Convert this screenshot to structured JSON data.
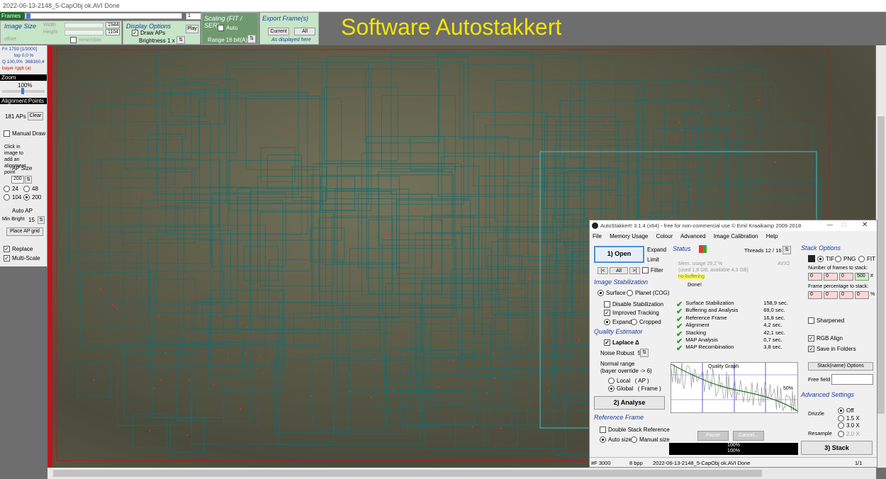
{
  "titlebar": {
    "text": "2022-06-13-2148_5-CapObj ok.AVI  Done"
  },
  "frames": {
    "label": "Frames",
    "current": "1"
  },
  "image_size": {
    "title": "Image Size",
    "width_label": "Width",
    "width_value": "1944",
    "height_label": "Height",
    "height_value": "1104",
    "remember": "remember",
    "offset": "offset"
  },
  "display_options": {
    "title": "Display Options",
    "draw_aps": "Draw APs",
    "brightness": "Brightness",
    "brightness_value": "1 x",
    "play": "Play"
  },
  "scaling": {
    "title": "Scaling (FIT / SER)",
    "auto": "Auto",
    "range": "Range 16 bit(A)"
  },
  "export": {
    "title": "Export Frame(s)",
    "current": "Current",
    "all": "All",
    "note": "As displayed here"
  },
  "heading": "Software Autostakkert",
  "left": {
    "frame_info": "F# 1759 [1/3000]",
    "top": "top 0,0 %",
    "q": "Q 100,0%",
    "q2": "368160,4",
    "bayer": "bayer rggb (a)",
    "zoom_title": "Zoom",
    "zoom_value": "100%",
    "ap_title": "Alignment Points",
    "ap_count": "181 APs",
    "clear": "Clear",
    "manual_draw": "Manual Draw",
    "click_hint": "Click in image to add an alignment point",
    "ap_size": "AP Size",
    "ap_size_value": "200",
    "sizes": [
      "24",
      "48",
      "104",
      "200"
    ],
    "auto_ap": "Auto AP",
    "min_bright": "Min Bright",
    "min_bright_value": "15",
    "place_grid": "Place AP grid",
    "replace": "Replace",
    "multiscale": "Multi-Scale"
  },
  "as": {
    "title": "AutoStakkert! 3.1.4 (x64) - free for non-commercial use © Emil Kraaikamp 2009-2018",
    "menu": [
      "File",
      "Memory Usage",
      "Colour",
      "Advanced",
      "Image Calibration",
      "Help"
    ],
    "open": "1) Open",
    "expand": "Expand",
    "limit": "Limit",
    "nav": [
      "|<",
      "All",
      ">|"
    ],
    "filter": "Filter",
    "stab_title": "Image Stabilization",
    "surface": "Surface",
    "planet": "Planet (COG)",
    "disable_stab": "Disable Stabilization",
    "improved_tracking": "Improved Tracking",
    "expand_opt": "Expand",
    "cropped": "Cropped",
    "qe_title": "Quality Estimator",
    "laplace": "Laplace Δ",
    "noise_robust": "Noise Robust",
    "noise_value": "5",
    "normal_range": "Normal range",
    "bayer_override": "(bayer override -> 6)",
    "local": "Local",
    "local_ap": "( AP )",
    "global": "Global",
    "global_frame": "( Frame )",
    "analyse": "2) Analyse",
    "ref_title": "Reference Frame",
    "double_stack": "Double Stack Reference",
    "auto_size": "Auto size",
    "manual_size": "Manual size",
    "status_title": "Status",
    "threads": "Threads 12 / 16",
    "mem": "Mem. usage 29,2 %",
    "mem_detail": "(used 1,8 GB, available 4,3 GB)",
    "avx": "AVX2",
    "buffering": "no buffering",
    "done": "Done!",
    "times": [
      {
        "label": "Surface Stabilization",
        "value": "158,9 sec."
      },
      {
        "label": "Buffering and Analysis",
        "value": "69,0 sec."
      },
      {
        "label": "Reference Frame",
        "value": "16,8 sec."
      },
      {
        "label": "Alignment",
        "value": "4,2 sec."
      },
      {
        "label": "Stacking",
        "value": "42,1 sec."
      },
      {
        "label": "MAP Analysis",
        "value": "0,7 sec."
      },
      {
        "label": "MAP Recombination",
        "value": "3,8 sec."
      }
    ],
    "quality_graph": "Quality Graph",
    "pct50": "50%",
    "pause": "Pause",
    "cancel": "Cancel...",
    "progress1": "100%",
    "progress2": "100%",
    "stack_title": "Stack Options",
    "formats": [
      "TIF",
      "PNG",
      "FIT"
    ],
    "frames_to_stack": "Number of frames to stack:",
    "frame_fields": [
      "0",
      "0",
      "0",
      "500"
    ],
    "frame_pct": "Frame percentage to stack:",
    "pct_fields": [
      "0",
      "0",
      "0",
      "0"
    ],
    "hash": "#",
    "pct_sym": "%",
    "sharpened": "Sharpened",
    "rgb_align": "RGB Align",
    "save_folders": "Save in Folders",
    "stackname": "Stack(name) Options",
    "free_field": "Free field",
    "adv_title": "Advanced Settings",
    "drizzle": "Drizzle",
    "drizzle_opts": [
      "Off",
      "1.5 X",
      "3.0 X"
    ],
    "resample": "Resample",
    "resample_opt": "2.0 X",
    "stack_btn": "3) Stack",
    "status_bar": {
      "frames": "#F 3000",
      "bpp": "8 bpp",
      "file": "2022-06-13-2148_5-CapObj ok.AVI  Done",
      "page": "1/1"
    }
  },
  "colors": {
    "green_panel": "#c7e5c7",
    "scaling_panel": "#6f9a6f",
    "heading": "#f2e600",
    "grid": "#1b6b6b",
    "red": "#c0141b"
  }
}
